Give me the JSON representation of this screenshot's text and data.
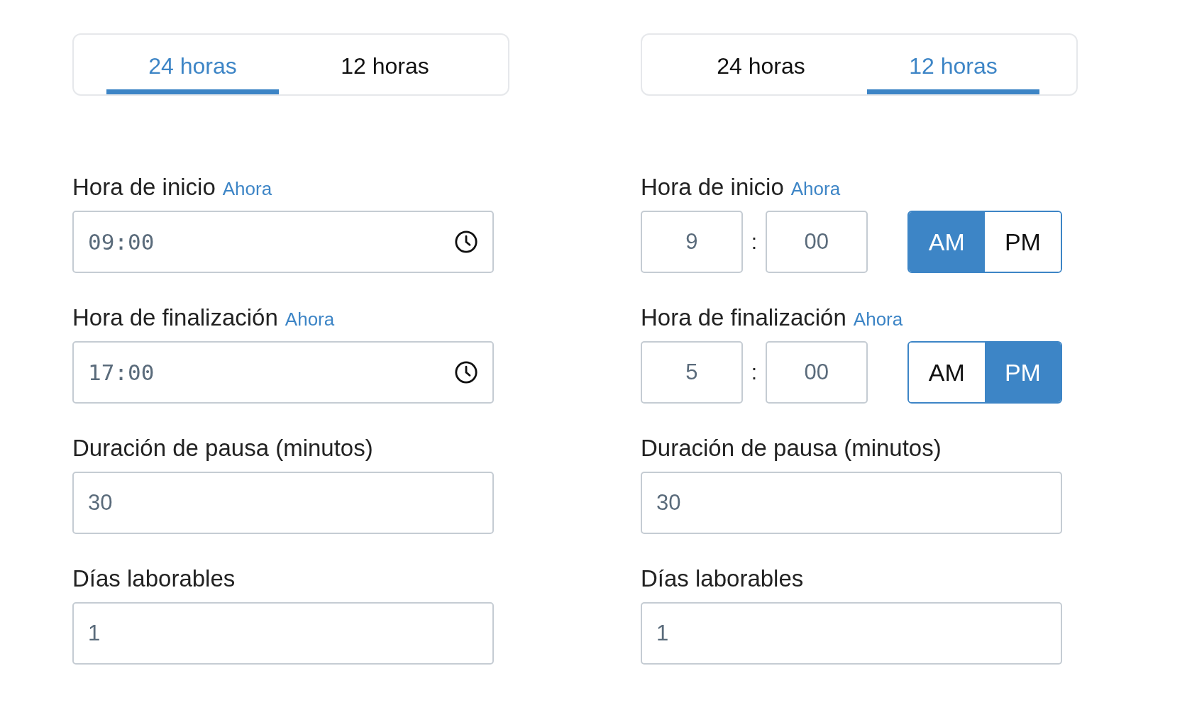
{
  "panels": [
    {
      "tabs": [
        {
          "label": "24 horas",
          "selected": true
        },
        {
          "label": "12 horas",
          "selected": false
        }
      ],
      "fields": [
        {
          "kind": "time24",
          "label": "Hora de inicio",
          "link": "Ahora",
          "value": "09:00"
        },
        {
          "kind": "time24",
          "label": "Hora de finalización",
          "link": "Ahora",
          "value": "17:00"
        },
        {
          "kind": "number",
          "label": "Duración de pausa (minutos)",
          "value": "30"
        },
        {
          "kind": "number",
          "label": "Días laborables",
          "value": "1"
        }
      ]
    },
    {
      "tabs": [
        {
          "label": "24 horas",
          "selected": false
        },
        {
          "label": "12 horas",
          "selected": true
        }
      ],
      "fields": [
        {
          "kind": "time12",
          "label": "Hora de inicio",
          "link": "Ahora",
          "hour": "9",
          "separator": ":",
          "minute": "00",
          "periods": [
            {
              "label": "AM",
              "selected": true
            },
            {
              "label": "PM",
              "selected": false
            }
          ]
        },
        {
          "kind": "time12",
          "label": "Hora de finalización",
          "link": "Ahora",
          "hour": "5",
          "separator": ":",
          "minute": "00",
          "periods": [
            {
              "label": "AM",
              "selected": false
            },
            {
              "label": "PM",
              "selected": true
            }
          ]
        },
        {
          "kind": "number",
          "label": "Duración de pausa (minutos)",
          "value": "30"
        },
        {
          "kind": "number",
          "label": "Días laborables",
          "value": "1"
        }
      ]
    }
  ]
}
